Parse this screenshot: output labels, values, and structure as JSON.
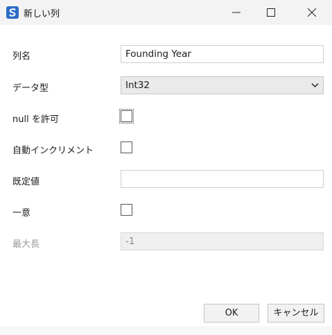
{
  "window": {
    "title": "新しい列",
    "icon": "app-logo-icon",
    "controls": [
      "minimize-icon",
      "maximize-icon",
      "close-icon"
    ]
  },
  "form": {
    "column_name": {
      "label": "列名",
      "value": "Founding Year"
    },
    "data_type": {
      "label": "データ型",
      "value": "Int32"
    },
    "allow_null": {
      "label": "null を許可",
      "checked": false
    },
    "auto_increment": {
      "label": "自動インクリメント",
      "checked": false
    },
    "default_value": {
      "label": "既定値",
      "value": ""
    },
    "unique": {
      "label": "一意",
      "checked": false
    },
    "max_length": {
      "label": "最大長",
      "value": "-1",
      "disabled": true
    }
  },
  "buttons": {
    "ok": "OK",
    "cancel": "キャンセル"
  },
  "colors": {
    "app_icon": "#2a6cc8",
    "titlebar": "#f3f3f3"
  }
}
